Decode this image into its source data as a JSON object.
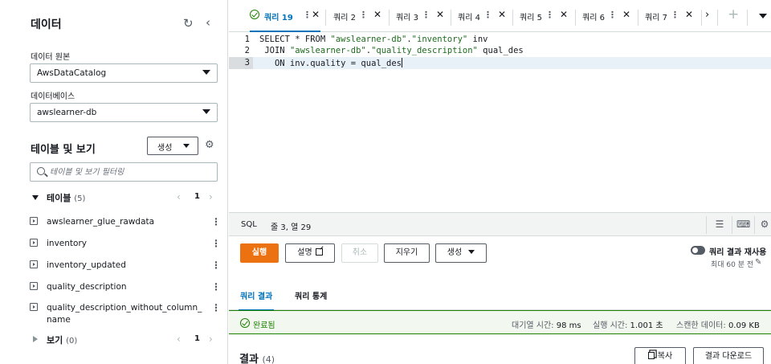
{
  "left_panel": {
    "title": "데이터",
    "datasource": {
      "label": "데이터 원본",
      "value": "AwsDataCatalog"
    },
    "database": {
      "label": "데이터베이스",
      "value": "awslearner-db"
    },
    "tables_views": {
      "title": "테이블 및 보기",
      "create_label": "생성",
      "search_placeholder": "테이블 및 보기 필터링"
    },
    "tables_group": {
      "label": "테이블",
      "count": "(5)",
      "page": "1"
    },
    "tables": [
      "awslearner_glue_rawdata",
      "inventory",
      "inventory_updated",
      "quality_description",
      "quality_description_without_column_name"
    ],
    "views_group": {
      "label": "보기",
      "count": "(0)",
      "page": "1"
    }
  },
  "tabs": [
    {
      "label": "쿼리 19",
      "active": true
    },
    {
      "label": "쿼리 2"
    },
    {
      "label": "쿼리 3"
    },
    {
      "label": "쿼리 4"
    },
    {
      "label": "쿼리 5"
    },
    {
      "label": "쿼리 6"
    },
    {
      "label": "쿼리 7"
    }
  ],
  "editor": {
    "lines": [
      {
        "num": "1",
        "pre": "SELECT * FROM ",
        "s1": "\"awslearner-db\"",
        "mid": ".",
        "s2": "\"inventory\"",
        "post": " inv"
      },
      {
        "num": "2",
        "pre": " JOIN ",
        "s1": "\"awslearner-db\"",
        "mid": ".",
        "s2": "\"quality_description\"",
        "post": " qual_des"
      },
      {
        "num": "3",
        "pre": "   ON inv.quality = qual_des",
        "s1": "",
        "mid": "",
        "s2": "",
        "post": ""
      }
    ]
  },
  "status_bar": {
    "language": "SQL",
    "position": "줄 3, 열 29"
  },
  "actions": {
    "run": "실행",
    "explain": "설명",
    "cancel": "취소",
    "clear": "지우기",
    "create": "생성",
    "reuse_label": "쿼리 결과 재사용",
    "reuse_sub": "최대 60 분 전"
  },
  "result_tabs": {
    "results": "쿼리 결과",
    "stats": "쿼리 통계"
  },
  "completion": {
    "status": "완료됨",
    "queue_label": "대기열 시간:",
    "queue_value": "98 ms",
    "run_label": "실행 시간:",
    "run_value": "1.001 초",
    "scan_label": "스캔한 데이터:",
    "scan_value": "0.09 KB"
  },
  "results": {
    "title": "결과",
    "count": "(4)",
    "copy": "복사",
    "download": "결과 다운로드"
  },
  "colors": {
    "accent": "#0073bb",
    "primary_button": "#ec7211",
    "success": "#1d8102"
  }
}
